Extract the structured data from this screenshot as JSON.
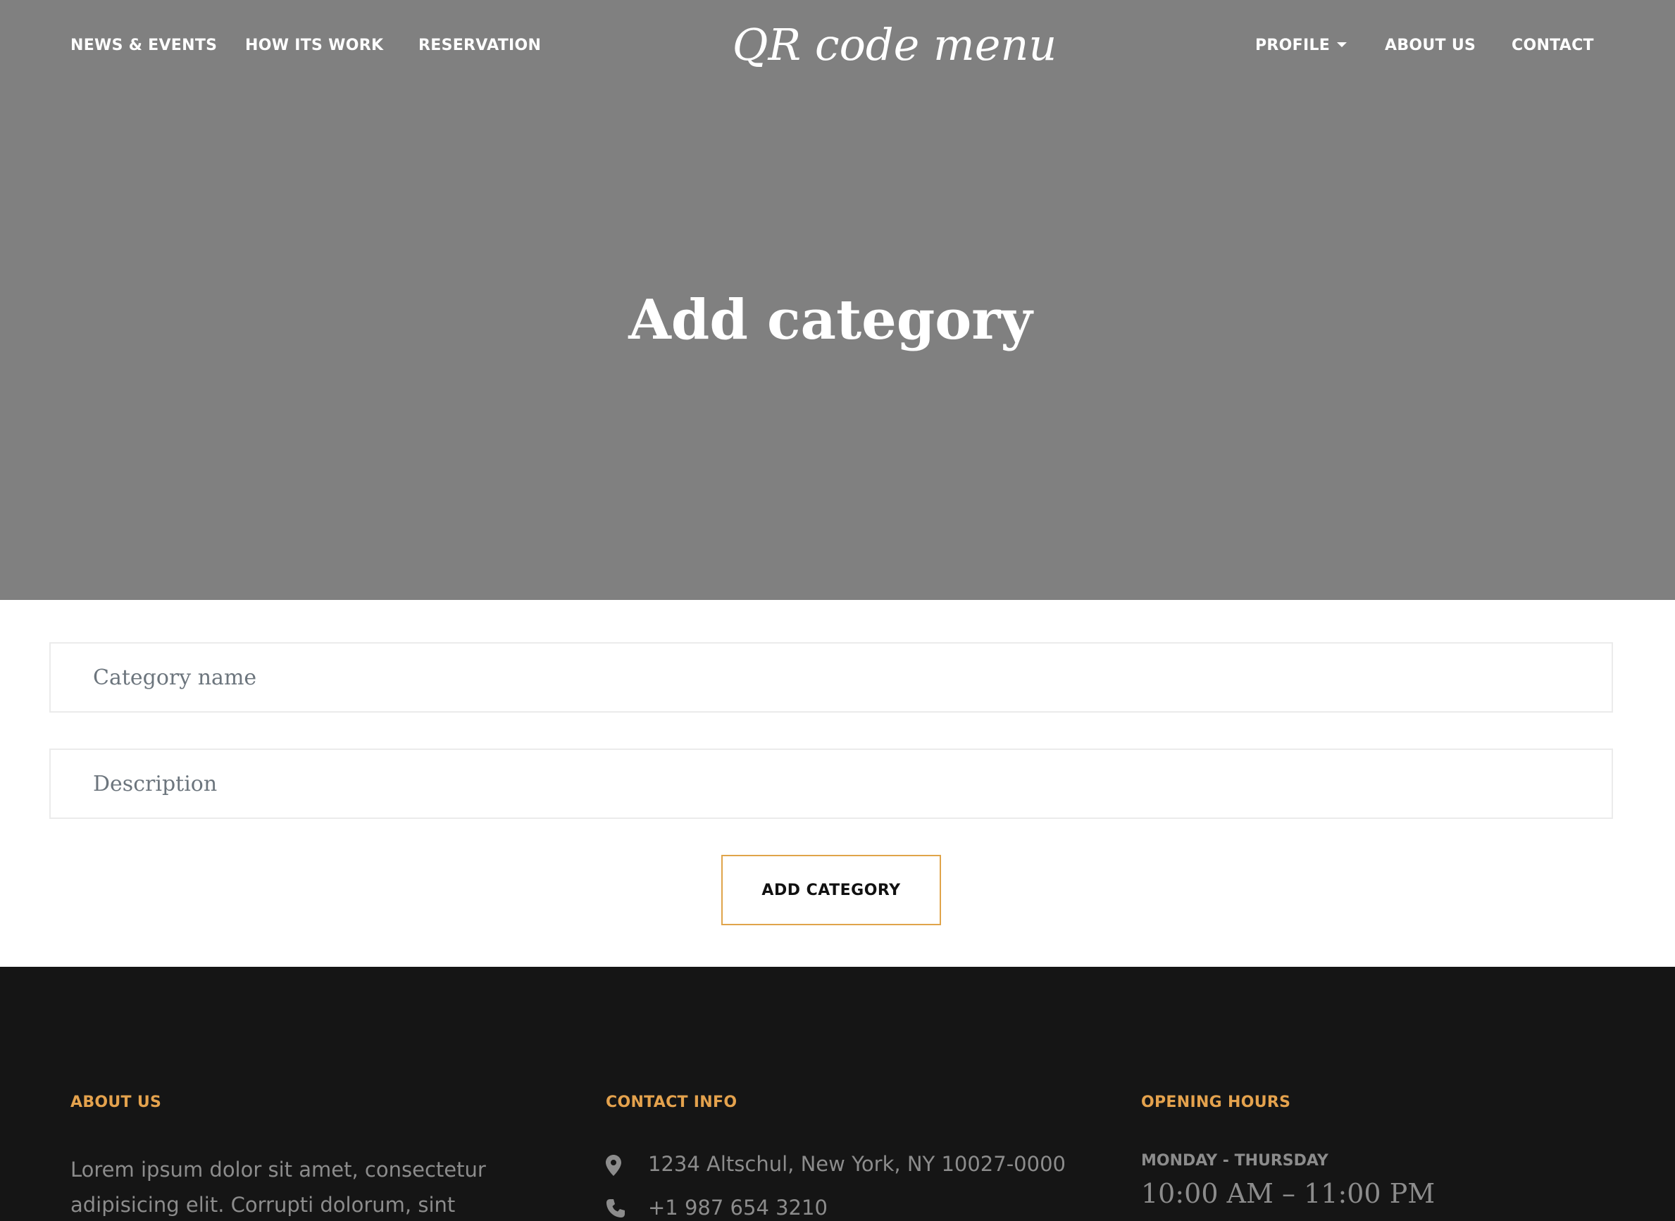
{
  "nav": {
    "left": [
      "NEWS & EVENTS",
      "HOW ITS WORK",
      "RESERVATION"
    ],
    "logo": "QR code menu",
    "right": [
      "PROFILE",
      "ABOUT US",
      "CONTACT"
    ]
  },
  "hero": {
    "title": "Add category"
  },
  "form": {
    "category_placeholder": "Category name",
    "description_placeholder": "Description",
    "submit_label": "ADD CATEGORY",
    "accent_color": "#e0a44a"
  },
  "footer": {
    "about": {
      "heading": "ABOUT US",
      "text": "Lorem ipsum dolor sit amet, consectetur adipisicing elit. Corrupti dolorum, sint corporis"
    },
    "contact": {
      "heading": "CONTACT INFO",
      "address": "1234 Altschul, New York, NY 10027-0000",
      "phone": "+1 987 654 3210",
      "address_icon": "map-pin-icon",
      "phone_icon": "phone-icon"
    },
    "hours": {
      "heading": "OPENING HOURS",
      "days": "MONDAY - THURSDAY",
      "time": "10:00 AM – 11:00 PM"
    },
    "heading_color": "#e4a24d"
  }
}
